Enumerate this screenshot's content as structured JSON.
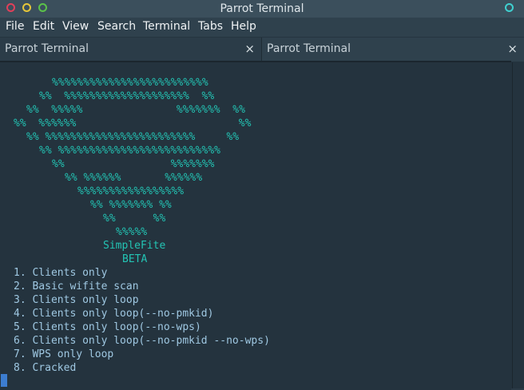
{
  "window": {
    "title": "Parrot Terminal"
  },
  "menu": [
    "File",
    "Edit",
    "View",
    "Search",
    "Terminal",
    "Tabs",
    "Help"
  ],
  "tabs": [
    {
      "label": "Parrot Terminal",
      "close": "×",
      "active": true
    },
    {
      "label": "Parrot Terminal",
      "close": "×",
      "active": false
    }
  ],
  "logo_art": [
    "%%%%%%%%%%%%%%%%%%%%%%%%%",
    "%%  %%%%%%%%%%%%%%%%%%%%  %%",
    "%%  %%%%%               %%%%%%%  %%",
    "%%  %%%%%%                          %%",
    "%% %%%%%%%%%%%%%%%%%%%%%%%%     %%",
    "%% %%%%%%%%%%%%%%%%%%%%%%%%%%",
    "%%                 %%%%%%%",
    "%% %%%%%%       %%%%%%",
    "%%%%%%%%%%%%%%%%%",
    "%% %%%%%%% %%",
    "%%      %%",
    "%%%%%"
  ],
  "app_name": "SimpleFite",
  "app_subtitle": "BETA",
  "options": [
    "1. Clients only",
    "2. Basic wifite scan",
    "3. Clients only loop",
    "4. Clients only loop(--no-pmkid)",
    "5. Clients only loop(--no-wps)",
    "6. Clients only loop(--no-pmkid --no-wps)",
    "7. WPS only loop",
    "8. Cracked"
  ],
  "colors": {
    "art": "#23c4b4",
    "menu_text": "#9fc8e2",
    "background": "#24333e",
    "cursor": "#3c7dd0"
  }
}
